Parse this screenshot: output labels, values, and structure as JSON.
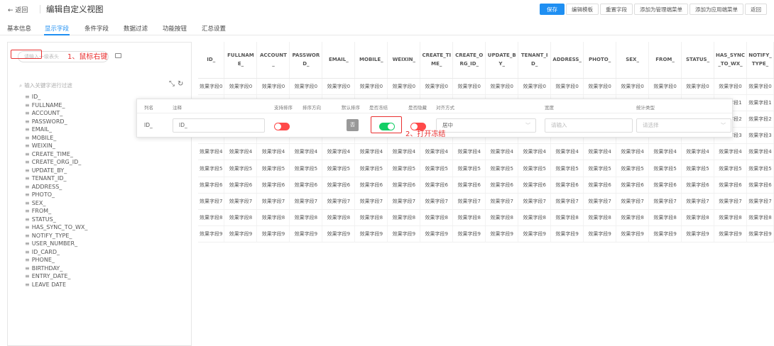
{
  "header": {
    "back_label": "← 返回",
    "title": "编辑自定义视图",
    "actions": [
      "保存",
      "编辑模板",
      "重置字段",
      "添加为管理端菜单",
      "添加为应用端菜单",
      "返回"
    ]
  },
  "tabs": [
    "基本信息",
    "显示字段",
    "条件字段",
    "数据过滤",
    "功能按钮",
    "汇总设置"
  ],
  "active_tab": "显示字段",
  "left_panel": {
    "search_placeholder": "请输入一级表头",
    "filter_placeholder": "输入关键字进行过滤",
    "fields": [
      "ID_",
      "FULLNAME_",
      "ACCOUNT_",
      "PASSWORD_",
      "EMAIL_",
      "MOBILE_",
      "WEIXIN_",
      "CREATE_TIME_",
      "CREATE_ORG_ID_",
      "UPDATE_BY_",
      "TENANT_ID_",
      "ADDRESS_",
      "PHOTO_",
      "SEX_",
      "FROM_",
      "STATUS_",
      "HAS_SYNC_TO_WX_",
      "NOTIFY_TYPE_",
      "USER_NUMBER_",
      "ID_CARD_",
      "PHONE_",
      "BIRTHDAY_",
      "ENTRY_DATE_",
      "LEAVE DATE"
    ],
    "annotation": "1、鼠标右键"
  },
  "grid": {
    "columns": [
      "ID_",
      "FULLNAME_",
      "ACCOUNT_",
      "PASSWORD_",
      "EMAIL_",
      "MOBILE_",
      "WEIXIN_",
      "CREATE_TIME_",
      "CREATE_ORG_ID_",
      "UPDATE_BY_",
      "TENANT_ID_",
      "ADDRESS_",
      "PHOTO_",
      "SEX_",
      "FROM_",
      "STATUS_",
      "HAS_SYNC_TO_WX_",
      "NOTIFY_TYPE_"
    ],
    "cell_prefix": "效果字段",
    "row_count": 10
  },
  "popover": {
    "headers": [
      "列名",
      "注释",
      "支持排序",
      "排序方向",
      "默认排序",
      "是否冻结",
      "是否隐藏",
      "对齐方式",
      "宽度",
      "统计类型"
    ],
    "column_name": "ID_",
    "comment_value": "ID_",
    "sort_button": "否",
    "align_value": "居中",
    "width_placeholder": "请输入",
    "stat_placeholder": "请选择",
    "annotation": "2、打开冻结",
    "toggle_on_color": "#13ce66",
    "toggle_off_color": "#ff4949"
  }
}
